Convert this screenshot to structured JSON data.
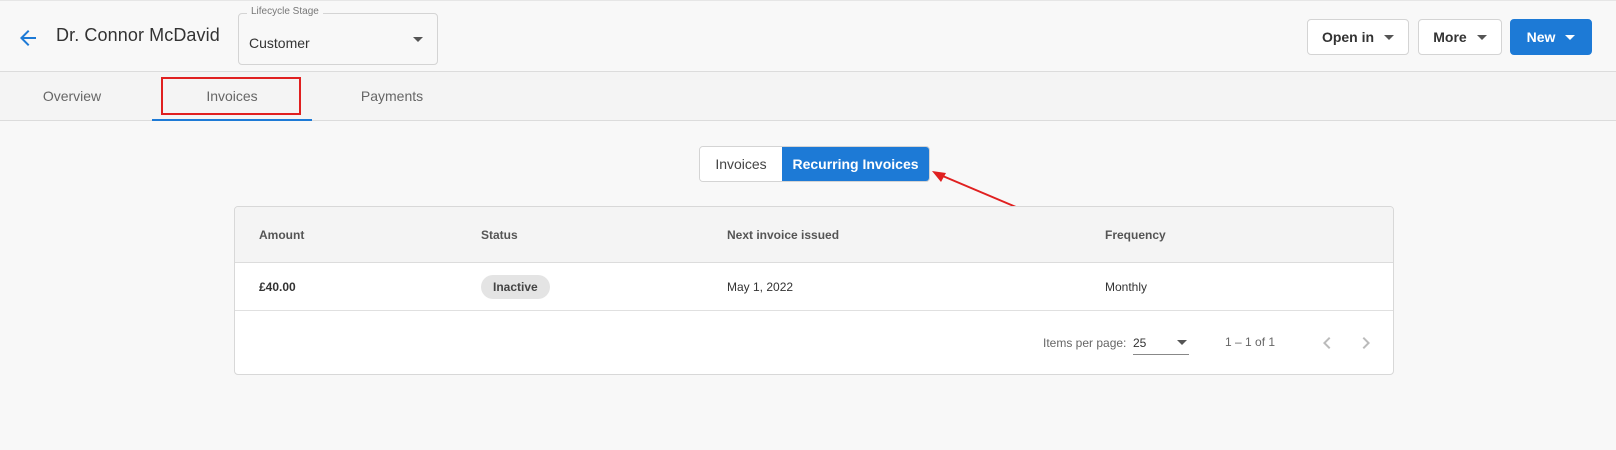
{
  "header": {
    "contact_name": "Dr. Connor McDavid",
    "back_icon": "arrow-left-icon",
    "lifecycle": {
      "label": "Lifecycle Stage",
      "value": "Customer"
    },
    "buttons": {
      "open_in": "Open in",
      "more": "More",
      "new": "New"
    }
  },
  "tabs": [
    {
      "label": "Overview",
      "active": false
    },
    {
      "label": "Invoices",
      "active": true
    },
    {
      "label": "Payments",
      "active": false
    }
  ],
  "invoice_toggle": {
    "invoices": "Invoices",
    "recurring": "Recurring Invoices",
    "selected": "Recurring Invoices"
  },
  "table": {
    "columns": [
      "Amount",
      "Status",
      "Next invoice issued",
      "Frequency"
    ],
    "rows": [
      {
        "amount": "£40.00",
        "status": "Inactive",
        "next_invoice": "May 1, 2022",
        "frequency": "Monthly"
      }
    ]
  },
  "paginator": {
    "items_per_page_label": "Items per page:",
    "items_per_page": "25",
    "range": "1 – 1 of 1"
  },
  "colors": {
    "primary": "#1d7ad6",
    "annotation": "#e02020",
    "badge_bg": "#e4e4e4"
  }
}
